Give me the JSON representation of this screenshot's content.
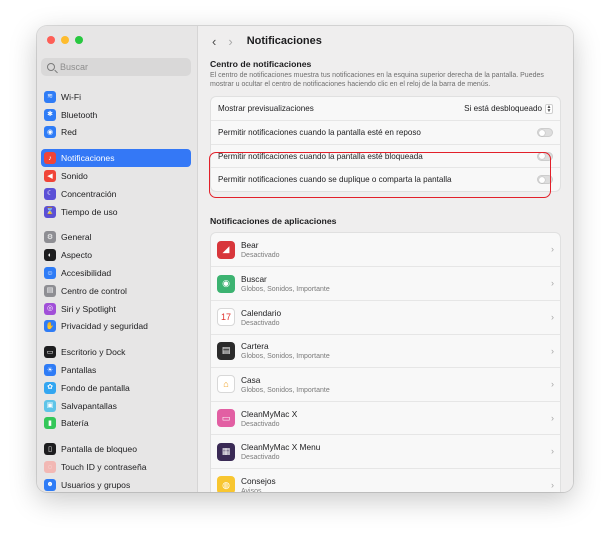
{
  "header": {
    "title": "Notificaciones"
  },
  "search": {
    "placeholder": "Buscar"
  },
  "sidebar": {
    "items": [
      {
        "label": "Wi-Fi",
        "icon": "wifi-icon",
        "color": "#2f7cf6",
        "glyph": "≋"
      },
      {
        "label": "Bluetooth",
        "icon": "bluetooth-icon",
        "color": "#2f7cf6",
        "glyph": "✱"
      },
      {
        "label": "Red",
        "icon": "network-icon",
        "color": "#2f7cf6",
        "glyph": "◉"
      },
      {
        "label": "Notificaciones",
        "icon": "bell-icon",
        "color": "#f04438",
        "glyph": "♪"
      },
      {
        "label": "Sonido",
        "icon": "speaker-icon",
        "color": "#f04438",
        "glyph": "◀"
      },
      {
        "label": "Concentración",
        "icon": "moon-icon",
        "color": "#5b50d6",
        "glyph": "☾"
      },
      {
        "label": "Tiempo de uso",
        "icon": "hourglass-icon",
        "color": "#5b50d6",
        "glyph": "⌛"
      },
      {
        "label": "General",
        "icon": "gear-icon",
        "color": "#8e8e93",
        "glyph": "⚙"
      },
      {
        "label": "Aspecto",
        "icon": "appearance-icon",
        "color": "#1d1d1f",
        "glyph": "◐"
      },
      {
        "label": "Accesibilidad",
        "icon": "accessibility-icon",
        "color": "#2f7cf6",
        "glyph": "☺"
      },
      {
        "label": "Centro de control",
        "icon": "control-center-icon",
        "color": "#8e8e93",
        "glyph": "▤"
      },
      {
        "label": "Siri y Spotlight",
        "icon": "siri-icon",
        "color": "#a14fd8",
        "glyph": "◎"
      },
      {
        "label": "Privacidad y seguridad",
        "icon": "hand-icon",
        "color": "#2f7cf6",
        "glyph": "✋"
      },
      {
        "label": "Escritorio y Dock",
        "icon": "dock-icon",
        "color": "#1d1d1f",
        "glyph": "▭"
      },
      {
        "label": "Pantallas",
        "icon": "display-icon",
        "color": "#2f7cf6",
        "glyph": "☀"
      },
      {
        "label": "Fondo de pantalla",
        "icon": "wallpaper-icon",
        "color": "#33a6f1",
        "glyph": "✿"
      },
      {
        "label": "Salvapantallas",
        "icon": "screensaver-icon",
        "color": "#5ec4e8",
        "glyph": "▣"
      },
      {
        "label": "Batería",
        "icon": "battery-icon",
        "color": "#34c759",
        "glyph": "▮"
      },
      {
        "label": "Pantalla de bloqueo",
        "icon": "lock-screen-icon",
        "color": "#1d1d1f",
        "glyph": "▯"
      },
      {
        "label": "Touch ID y contraseña",
        "icon": "fingerprint-icon",
        "color": "#f2b8b4",
        "glyph": "◌"
      },
      {
        "label": "Usuarios y grupos",
        "icon": "users-icon",
        "color": "#2f7cf6",
        "glyph": "☻"
      }
    ]
  },
  "center": {
    "title": "Centro de notificaciones",
    "description": "El centro de notificaciones muestra tus notificaciones en la esquina superior derecha de la pantalla. Puedes mostrar u ocultar el centro de notificaciones haciendo clic en el reloj de la barra de menús.",
    "preview_label": "Mostrar previsualizaciones",
    "preview_value": "Si está desbloqueado",
    "sleep_label": "Permitir notificaciones cuando la pantalla esté en reposo",
    "locked_label": "Permitir notificaciones cuando la pantalla esté bloqueada",
    "mirror_label": "Permitir notificaciones cuando se duplique o comparta la pantalla"
  },
  "apps": {
    "title": "Notificaciones de aplicaciones",
    "items": [
      {
        "name": "Bear",
        "status": "Desactivado",
        "icon": "bear-icon",
        "color": "#d8363b",
        "glyph": "◢"
      },
      {
        "name": "Buscar",
        "status": "Globos, Sonidos, Importante",
        "icon": "find-my-icon",
        "color": "#3cb371",
        "glyph": "◉"
      },
      {
        "name": "Calendario",
        "status": "Desactivado",
        "icon": "calendar-icon",
        "color": "#ffffff",
        "glyph": "17"
      },
      {
        "name": "Cartera",
        "status": "Globos, Sonidos, Importante",
        "icon": "wallet-icon",
        "color": "#2b2b2b",
        "glyph": "▤"
      },
      {
        "name": "Casa",
        "status": "Globos, Sonidos, Importante",
        "icon": "home-icon",
        "color": "#ffffff",
        "glyph": "⌂"
      },
      {
        "name": "CleanMyMac X",
        "status": "Desactivado",
        "icon": "cleanmymac-icon",
        "color": "#e25fa3",
        "glyph": "▭"
      },
      {
        "name": "CleanMyMac X Menu",
        "status": "Desactivado",
        "icon": "cleanmymac-menu-icon",
        "color": "#3a2a55",
        "glyph": "▦"
      },
      {
        "name": "Consejos",
        "status": "Avisos",
        "icon": "tips-icon",
        "color": "#f8c630",
        "glyph": "◍"
      }
    ]
  }
}
